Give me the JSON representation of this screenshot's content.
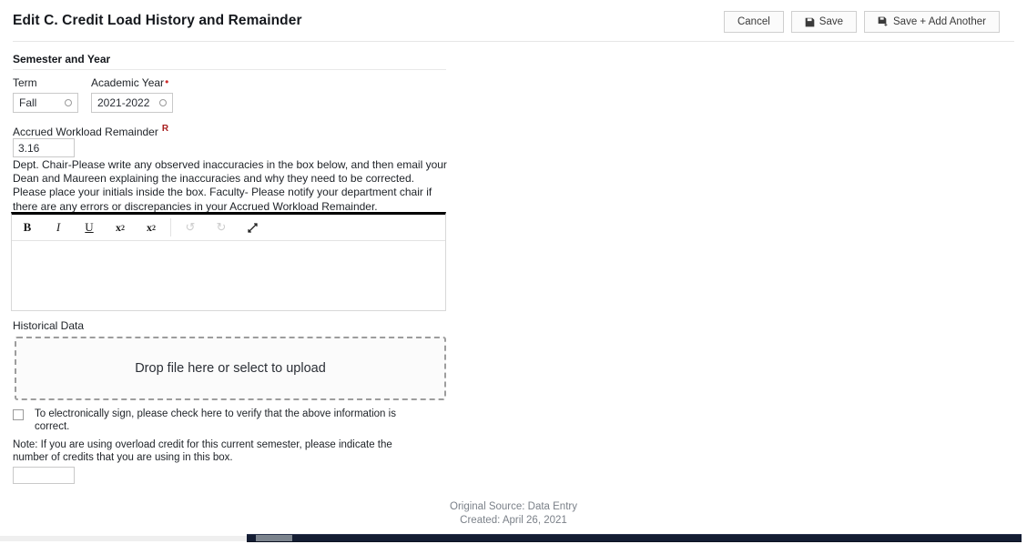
{
  "header": {
    "title": "Edit C. Credit Load History and Remainder",
    "buttons": [
      {
        "label": "Cancel",
        "icon": "none"
      },
      {
        "label": "Save",
        "icon": "floppy-disk-icon"
      },
      {
        "label": "Save + Add Another",
        "icon": "floppy-disk-plus-icon"
      }
    ]
  },
  "form": {
    "section_title": "Semester and Year",
    "term": {
      "label": "Term",
      "value": "Fall",
      "clear_icon": "clear-circle-icon"
    },
    "academic_year": {
      "label": "Academic Year",
      "required_marker": "•",
      "value": "2021-2022",
      "clear_icon": "clear-circle-icon"
    },
    "accrued_workload_remainder": {
      "label": "Accrued Workload Remainder",
      "required_marker": "R",
      "value": "3.16"
    },
    "instructions": "Dept. Chair-Please write any observed inaccuracies in the box below, and then email your Dean and Maureen explaining the inaccuracies and why they need to be corrected. Please place your initials inside the box. Faculty- Please notify your department chair if there are any errors or discrepancies in your Accrued Workload Remainder.",
    "editor": {
      "toolbar": [
        {
          "name": "bold",
          "label": "B"
        },
        {
          "name": "italic",
          "label": "I"
        },
        {
          "name": "underline",
          "label": "U"
        },
        {
          "name": "superscript",
          "label": "x"
        },
        {
          "name": "subscript",
          "label": "x"
        },
        {
          "name": "undo",
          "label": "↺"
        },
        {
          "name": "redo",
          "label": "↻"
        },
        {
          "name": "expand",
          "label": ""
        }
      ],
      "content": ""
    },
    "historical_data": {
      "label": "Historical Data",
      "dropzone_text": "Drop file here or select to upload"
    },
    "sign": {
      "checked": false,
      "label": "To electronically sign, please check here to verify that the above information is correct."
    },
    "note": {
      "text": "Note: If you are using overload credit for this current semester, please indicate the number of credits that you are using in this box.",
      "value": ""
    }
  },
  "footer": {
    "source": "Original Source: Data Entry",
    "created": "Created: April 26, 2021"
  },
  "colors": {
    "required_dot": "#cf2f2f",
    "required_r": "#a81d1d",
    "scrollbar_bar": "#141d33",
    "scrollbar_thumb": "#7b838d"
  }
}
